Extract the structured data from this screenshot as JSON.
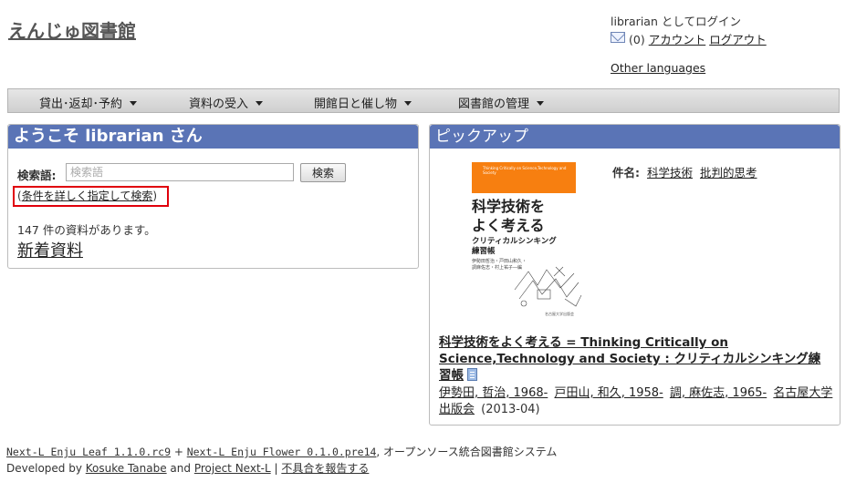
{
  "header": {
    "site_title": "えんじゅ図書館",
    "login_status": "librarian としてログイン",
    "message_count": "(0)",
    "account_link": "アカウント",
    "logout_link": "ログアウト",
    "other_languages": "Other languages"
  },
  "nav": {
    "items": [
      {
        "label": "貸出･返却･予約"
      },
      {
        "label": "資料の受入"
      },
      {
        "label": "開館日と催し物"
      },
      {
        "label": "図書館の管理"
      }
    ]
  },
  "welcome": {
    "title": "ようこそ librarian さん",
    "search_label": "検索語",
    "search_colon": ":",
    "search_placeholder": "検索語",
    "search_value": "",
    "search_button": "検索",
    "advanced_open": "(",
    "advanced_link": "条件を詳しく指定して検索",
    "advanced_close": ")",
    "count_text": "147 件の資料があります。",
    "new_items_link": "新着資料"
  },
  "pickup": {
    "title": "ピックアップ",
    "cover": {
      "band_text": "Thinking Critically on Science,Technology and Society",
      "title_line1": "科学技術を",
      "title_line2": "よく考える",
      "subtitle_line1": "クリティカルシンキング",
      "subtitle_line2": "練習帳",
      "authors_line1": "伊勢田哲治・戸田山和久・",
      "authors_line2": "調麻佐志・村上祐子―編",
      "publisher": "名古屋大学出版会"
    },
    "subject_label": "件名:",
    "subjects": [
      "科学技術",
      "批判的思考"
    ],
    "book_title": "科学技術をよく考える = Thinking Critically on Science,Technology and Society : クリティカルシンキング練習帳",
    "authors": [
      "伊勢田, 哲治, 1968-",
      "戸田山, 和久, 1958-",
      "調, 麻佐志, 1965-",
      "名古屋大学出版会"
    ],
    "pub_year": "(2013-04)"
  },
  "footer": {
    "leaf_link": "Next-L Enju Leaf 1.1.0.rc9",
    "plus": " + ",
    "flower_link": "Next-L Enju Flower 0.1.0.pre14",
    "system_text": ", オープンソース統合図書館システム",
    "developed_by": "Developed by ",
    "dev_name": "Kosuke Tanabe",
    "and_text": " and ",
    "project_link": "Project Next-L",
    "separator": " | ",
    "report_link": "不具合を報告する"
  },
  "colors": {
    "panel_header": "#5a74b6",
    "highlight_box": "#e0000b",
    "cover_band": "#f77f10"
  }
}
